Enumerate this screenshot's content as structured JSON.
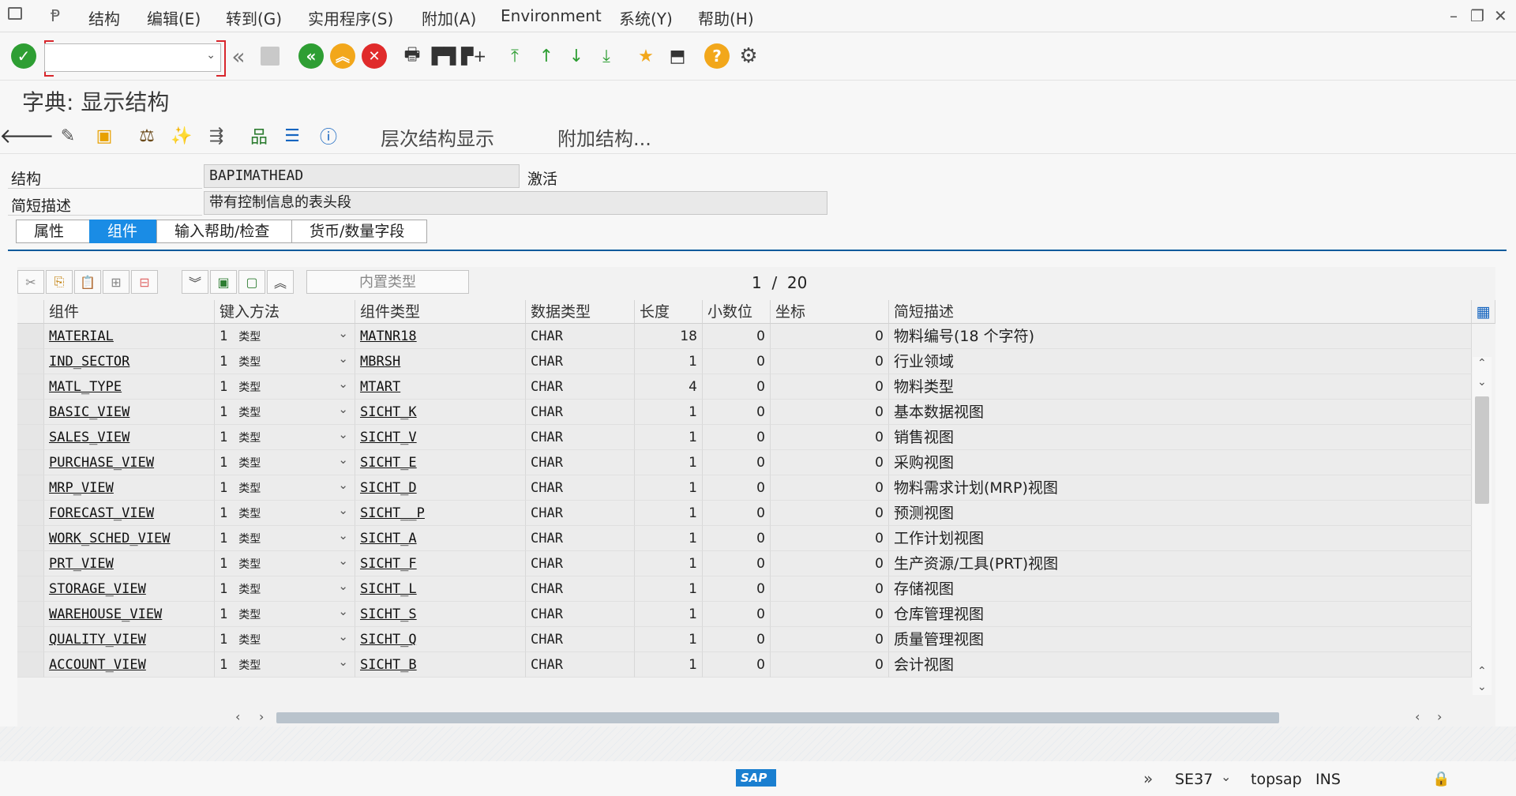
{
  "menubar": {
    "items": [
      "结构",
      "编辑(E)",
      "转到(G)",
      "实用程序(S)",
      "附加(A)",
      "Environment",
      "系统(Y)",
      "帮助(H)"
    ]
  },
  "toolbar": {
    "command_value": "",
    "icons": [
      "enter-icon",
      "back-nav-icon",
      "save-icon",
      "back-icon",
      "exit-icon",
      "cancel-icon",
      "print-icon",
      "find-icon",
      "find-next-icon",
      "first-page-icon",
      "prev-page-icon",
      "next-page-icon",
      "last-page-icon",
      "create-session-icon",
      "shortcut-icon",
      "help-icon",
      "settings-icon"
    ]
  },
  "title": "字典: 显示结构",
  "app_toolbar": {
    "hierarchy_label": "层次结构显示",
    "append_label": "附加结构..."
  },
  "fields": {
    "structure_label": "结构",
    "structure_value": "BAPIMATHEAD",
    "status": "激活",
    "short_desc_label": "简短描述",
    "short_desc_value": "带有控制信息的表头段"
  },
  "tabs": [
    {
      "label": "属性",
      "active": false
    },
    {
      "label": "组件",
      "active": true
    },
    {
      "label": "输入帮助/检查",
      "active": false
    },
    {
      "label": "货币/数量字段",
      "active": false
    }
  ],
  "grid_toolbar": {
    "builtin_type_label": "内置类型",
    "page_current": "1",
    "page_sep": "/",
    "page_total": "20"
  },
  "columns": [
    "组件",
    "键入方法",
    "组件类型",
    "数据类型",
    "长度",
    "小数位",
    "坐标",
    "简短描述"
  ],
  "rows": [
    {
      "component": "MATERIAL",
      "typing_num": "1",
      "typing": "类型",
      "comp_type": "MATNR18",
      "data_type": "CHAR",
      "length": "18",
      "decimals": "0",
      "coord": "0",
      "desc": "物料编号(18 个字符)"
    },
    {
      "component": "IND_SECTOR",
      "typing_num": "1",
      "typing": "类型",
      "comp_type": "MBRSH",
      "data_type": "CHAR",
      "length": "1",
      "decimals": "0",
      "coord": "0",
      "desc": "行业领域"
    },
    {
      "component": "MATL_TYPE",
      "typing_num": "1",
      "typing": "类型",
      "comp_type": "MTART",
      "data_type": "CHAR",
      "length": "4",
      "decimals": "0",
      "coord": "0",
      "desc": "物料类型"
    },
    {
      "component": "BASIC_VIEW",
      "typing_num": "1",
      "typing": "类型",
      "comp_type": "SICHT_K",
      "data_type": "CHAR",
      "length": "1",
      "decimals": "0",
      "coord": "0",
      "desc": "基本数据视图"
    },
    {
      "component": "SALES_VIEW",
      "typing_num": "1",
      "typing": "类型",
      "comp_type": "SICHT_V",
      "data_type": "CHAR",
      "length": "1",
      "decimals": "0",
      "coord": "0",
      "desc": "销售视图"
    },
    {
      "component": "PURCHASE_VIEW",
      "typing_num": "1",
      "typing": "类型",
      "comp_type": "SICHT_E",
      "data_type": "CHAR",
      "length": "1",
      "decimals": "0",
      "coord": "0",
      "desc": "采购视图"
    },
    {
      "component": "MRP_VIEW",
      "typing_num": "1",
      "typing": "类型",
      "comp_type": "SICHT_D",
      "data_type": "CHAR",
      "length": "1",
      "decimals": "0",
      "coord": "0",
      "desc": "物料需求计划(MRP)视图"
    },
    {
      "component": "FORECAST_VIEW",
      "typing_num": "1",
      "typing": "类型",
      "comp_type": "SICHT__P",
      "data_type": "CHAR",
      "length": "1",
      "decimals": "0",
      "coord": "0",
      "desc": "预测视图"
    },
    {
      "component": "WORK_SCHED_VIEW",
      "typing_num": "1",
      "typing": "类型",
      "comp_type": "SICHT_A",
      "data_type": "CHAR",
      "length": "1",
      "decimals": "0",
      "coord": "0",
      "desc": "工作计划视图"
    },
    {
      "component": "PRT_VIEW",
      "typing_num": "1",
      "typing": "类型",
      "comp_type": "SICHT_F",
      "data_type": "CHAR",
      "length": "1",
      "decimals": "0",
      "coord": "0",
      "desc": "生产资源/工具(PRT)视图"
    },
    {
      "component": "STORAGE_VIEW",
      "typing_num": "1",
      "typing": "类型",
      "comp_type": "SICHT_L",
      "data_type": "CHAR",
      "length": "1",
      "decimals": "0",
      "coord": "0",
      "desc": "存储视图"
    },
    {
      "component": "WAREHOUSE_VIEW",
      "typing_num": "1",
      "typing": "类型",
      "comp_type": "SICHT_S",
      "data_type": "CHAR",
      "length": "1",
      "decimals": "0",
      "coord": "0",
      "desc": "仓库管理视图"
    },
    {
      "component": "QUALITY_VIEW",
      "typing_num": "1",
      "typing": "类型",
      "comp_type": "SICHT_Q",
      "data_type": "CHAR",
      "length": "1",
      "decimals": "0",
      "coord": "0",
      "desc": "质量管理视图"
    },
    {
      "component": "ACCOUNT_VIEW",
      "typing_num": "1",
      "typing": "类型",
      "comp_type": "SICHT_B",
      "data_type": "CHAR",
      "length": "1",
      "decimals": "0",
      "coord": "0",
      "desc": "会计视图"
    }
  ],
  "statusbar": {
    "transaction": "SE37",
    "user": "topsap",
    "mode": "INS",
    "logo": "SAP"
  },
  "colors": {
    "accent": "#1a8ce5",
    "enter_green": "#2e9e33",
    "back_green": "#2e9e33",
    "exit_orange": "#f2a71b",
    "cancel_red": "#e02b2b",
    "help_orange": "#f2a71b",
    "tab_line": "#0a5b9c"
  }
}
